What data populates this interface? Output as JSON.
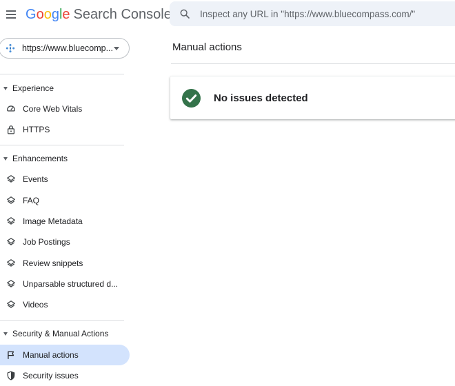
{
  "header": {
    "logo": {
      "g": "G",
      "o1": "o",
      "o2": "o",
      "g2": "g",
      "l": "l",
      "e": "e",
      "product": "Search Console"
    },
    "search_placeholder": "Inspect any URL in \"https://www.bluecompass.com/\""
  },
  "property": {
    "label": "https://www.bluecomp..."
  },
  "sidebar": {
    "sections": [
      {
        "label": "Experience"
      },
      {
        "label": "Enhancements"
      },
      {
        "label": "Security & Manual Actions"
      }
    ],
    "items": [
      {
        "label": "Core Web Vitals",
        "icon": "gauge-icon"
      },
      {
        "label": "HTTPS",
        "icon": "lock-icon"
      },
      {
        "label": "Events",
        "icon": "layers-icon"
      },
      {
        "label": "FAQ",
        "icon": "layers-icon"
      },
      {
        "label": "Image Metadata",
        "icon": "layers-icon"
      },
      {
        "label": "Job Postings",
        "icon": "layers-icon"
      },
      {
        "label": "Review snippets",
        "icon": "layers-icon"
      },
      {
        "label": "Unparsable structured d...",
        "icon": "layers-icon"
      },
      {
        "label": "Videos",
        "icon": "layers-icon"
      },
      {
        "label": "Manual actions",
        "icon": "flag-icon",
        "active": true
      },
      {
        "label": "Security issues",
        "icon": "shield-icon"
      }
    ]
  },
  "main": {
    "title": "Manual actions",
    "status_card": {
      "text": "No issues detected",
      "icon": "check-circle-icon"
    }
  },
  "colors": {
    "accent_active_bg": "#d3e3fd",
    "search_bg": "#eef2f8",
    "success_green": "#34734a"
  }
}
